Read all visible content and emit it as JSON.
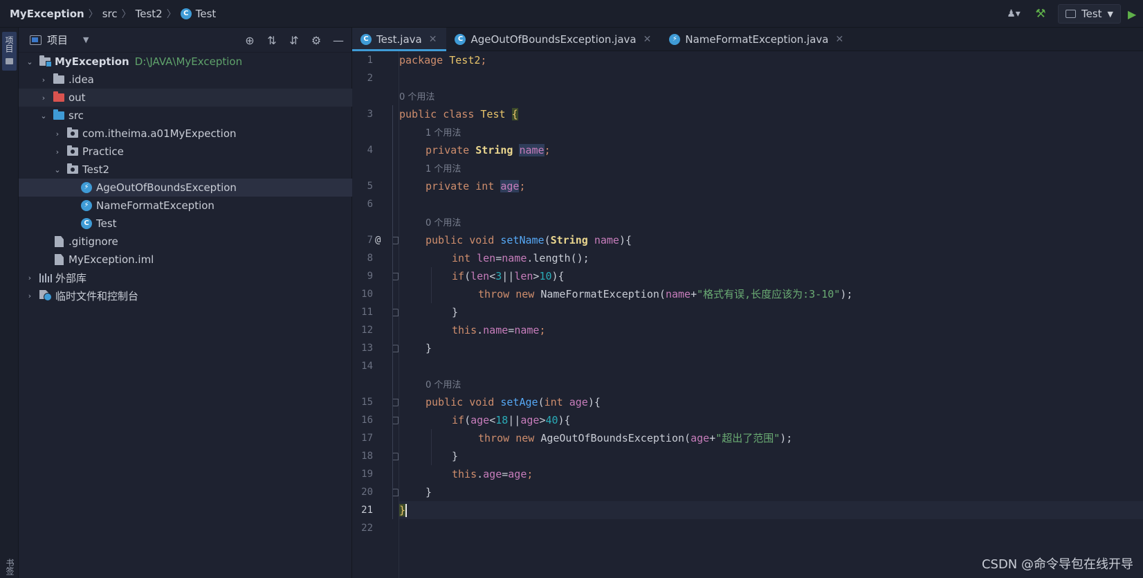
{
  "breadcrumb": [
    "MyException",
    "src",
    "Test2",
    "Test"
  ],
  "run_config": "Test",
  "left_stripe": {
    "project_tab": "项目",
    "bottom_tab": "书签"
  },
  "project_panel": {
    "title": "项目",
    "tree": [
      {
        "label": "MyException",
        "path": "D:\\JAVA\\MyException"
      },
      {
        "label": ".idea"
      },
      {
        "label": "out"
      },
      {
        "label": "src"
      },
      {
        "label": "com.itheima.a01MyExpection"
      },
      {
        "label": "Practice"
      },
      {
        "label": "Test2"
      },
      {
        "label": "AgeOutOfBoundsException"
      },
      {
        "label": "NameFormatException"
      },
      {
        "label": "Test"
      },
      {
        "label": ".gitignore"
      },
      {
        "label": "MyException.iml"
      },
      {
        "label": "外部库"
      },
      {
        "label": "临时文件和控制台"
      }
    ]
  },
  "tabs": [
    {
      "label": "Test.java",
      "active": true
    },
    {
      "label": "AgeOutOfBoundsException.java",
      "active": false
    },
    {
      "label": "NameFormatException.java",
      "active": false
    }
  ],
  "code": {
    "line_numbers": [
      "1",
      "2",
      "3",
      "4",
      "5",
      "6",
      "7",
      "8",
      "9",
      "10",
      "11",
      "12",
      "13",
      "14",
      "15",
      "16",
      "17",
      "18",
      "19",
      "20",
      "21",
      "22"
    ],
    "usage_hints": [
      "0 个用法",
      "1 个用法",
      "1 个用法",
      "0 个用法",
      "0 个用法"
    ],
    "tokens": {
      "package": "package",
      "pkg_name": "Test2",
      "semi": ";",
      "public": "public",
      "class": "class",
      "cls_name": "Test",
      "lbrace": "{",
      "rbrace": "}",
      "private": "private",
      "String": "String",
      "name": "name",
      "int": "int",
      "age": "age",
      "void": "void",
      "setName": "setName",
      "setAge": "setAge",
      "len": "len",
      "length_call": ".length();",
      "if": "if",
      "throw": "throw",
      "new": "new",
      "NameFormatException": "NameFormatException",
      "AgeOutOfBoundsException": "AgeOutOfBoundsException",
      "name_msg": "\"格式有误,长度应该为:3-10\"",
      "age_msg": "\"超出了范围\"",
      "this": "this",
      "n3": "3",
      "n10": "10",
      "n18": "18",
      "n40": "40"
    }
  },
  "watermark": "CSDN @命令导包在线开导"
}
